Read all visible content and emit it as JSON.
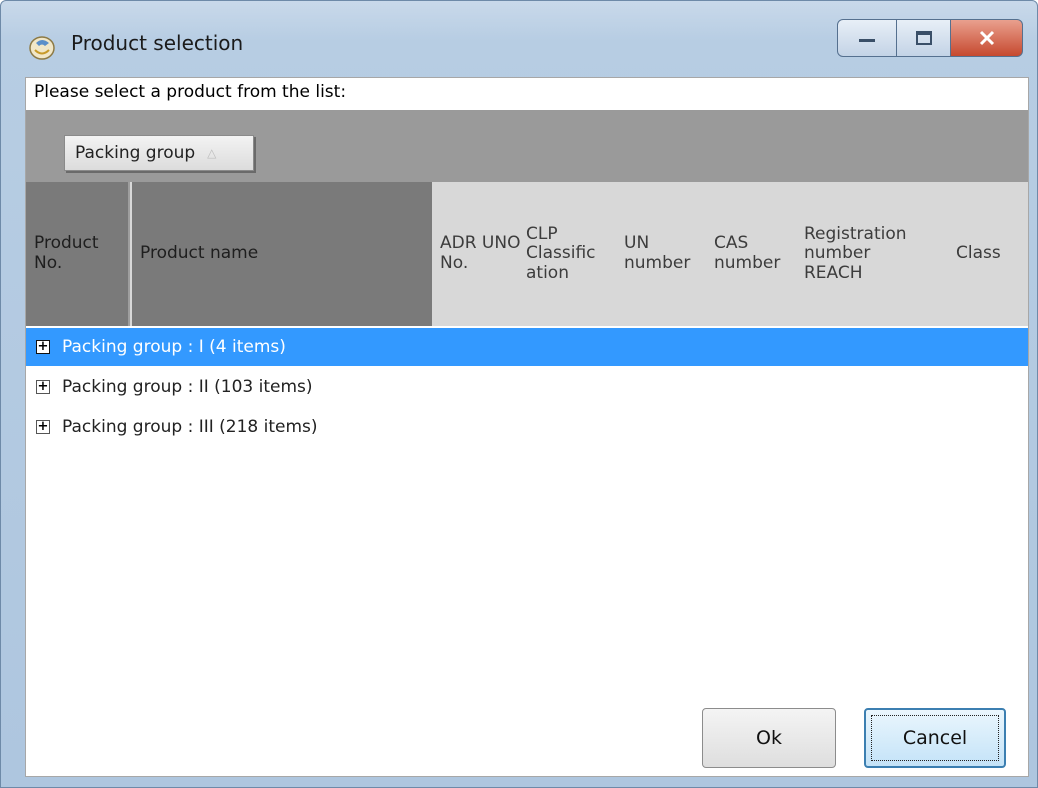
{
  "window": {
    "title": "Product selection",
    "controls": {
      "minimize": "minimize-icon",
      "maximize": "maximize-icon",
      "close": "close-icon"
    }
  },
  "prompt": "Please select a product from the list:",
  "group_panel": {
    "chip_label": "Packing group",
    "chip_sort_icon": "sort-ascending-triangle-icon"
  },
  "columns": {
    "product_no": "Product No.",
    "product_name": "Product name",
    "adr_uno_no": "ADR UNO No.",
    "clp_classification": "CLP Classific ation",
    "un_number": "UN number",
    "cas_number": "CAS number",
    "registration_number_reach": "Registration number REACH",
    "class": "Class"
  },
  "groups": [
    {
      "label": "Packing group : I (4 items)",
      "selected": true
    },
    {
      "label": "Packing group : II (103 items)",
      "selected": false
    },
    {
      "label": "Packing group : III (218 items)",
      "selected": false
    }
  ],
  "buttons": {
    "ok": "Ok",
    "cancel": "Cancel"
  },
  "colors": {
    "selection": "#3399ff",
    "group_panel": "#9a9a9a",
    "header_dark": "#7a7a7a",
    "header_light": "#d8d8d8"
  }
}
